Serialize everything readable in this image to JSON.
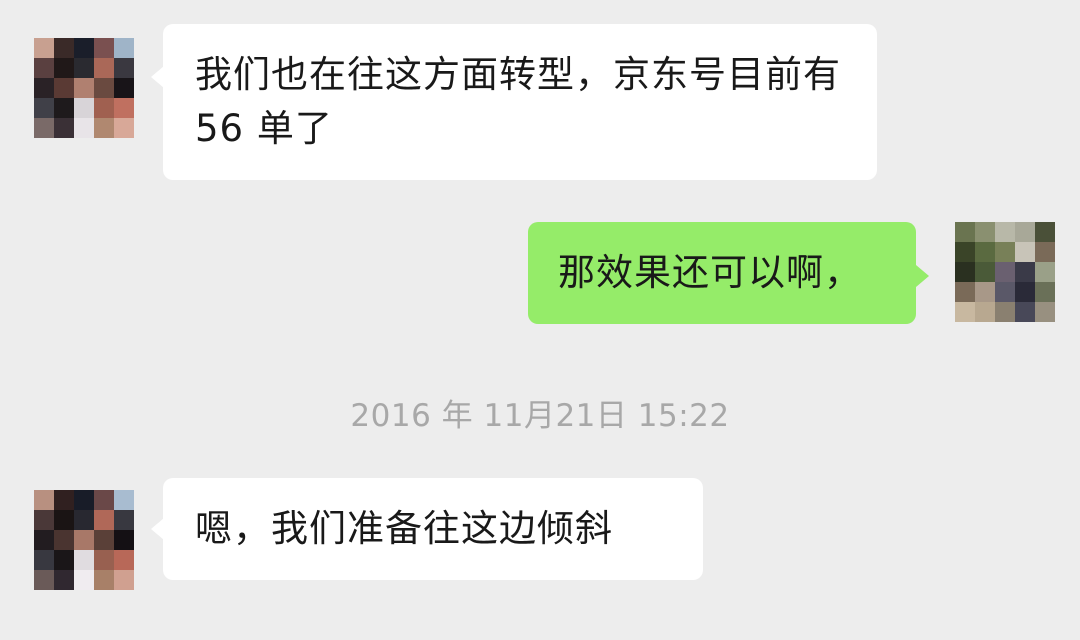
{
  "messages": [
    {
      "sender": "contact",
      "text": "我们也在往这方面转型，京东号目前有 56 单了"
    },
    {
      "sender": "me",
      "text": "那效果还可以啊，"
    },
    {
      "sender": "contact",
      "text": "嗯，我们准备往这边倾斜"
    }
  ],
  "timestamp": "2016 年 11月21日 15:22",
  "colors": {
    "background": "#ededed",
    "incoming_bubble": "#ffffff",
    "outgoing_bubble": "#95ec69",
    "message_text": "#191919",
    "timestamp_text": "#a8a8a8"
  },
  "avatars": {
    "contact": [
      [
        "#c8a090",
        "#3a2a28",
        "#1a1e2a",
        "#7a5050",
        "#9fb4c8"
      ],
      [
        "#5a4040",
        "#201818",
        "#2a2a30",
        "#aa6858",
        "#3a3840"
      ],
      [
        "#2a2226",
        "#5a3a34",
        "#b08070",
        "#6a4a40",
        "#181418"
      ],
      [
        "#404048",
        "#1e1a1c",
        "#d8d4d8",
        "#a06050",
        "#c07060"
      ],
      [
        "#7a6a68",
        "#3a3036",
        "#e8e4e8",
        "#b08870",
        "#d8a898"
      ]
    ],
    "contact_bottom": [
      [
        "#b89080",
        "#302020",
        "#181c28",
        "#6a4848",
        "#a8bcd0"
      ],
      [
        "#4a3838",
        "#1a1414",
        "#282830",
        "#b06858",
        "#383840"
      ],
      [
        "#221c20",
        "#4a3430",
        "#a87868",
        "#5a4038",
        "#141014"
      ],
      [
        "#383840",
        "#1a1618",
        "#e0dce0",
        "#986050",
        "#b86858"
      ],
      [
        "#6a5a58",
        "#302830",
        "#f0ecf0",
        "#a88068",
        "#d0a090"
      ]
    ],
    "me": [
      [
        "#6a7450",
        "#8a9070",
        "#b8b8a8",
        "#a8a898",
        "#4a5038"
      ],
      [
        "#3a4428",
        "#5a6a40",
        "#788058",
        "#c8c4b8",
        "#7a6a58"
      ],
      [
        "#2a3020",
        "#4a5a38",
        "#6a6070",
        "#3a3a48",
        "#9aa088"
      ],
      [
        "#7a6a58",
        "#a89888",
        "#5a5868",
        "#2a2a38",
        "#6a7058"
      ],
      [
        "#c8b8a0",
        "#b8a890",
        "#8a8070",
        "#484858",
        "#989080"
      ]
    ]
  }
}
